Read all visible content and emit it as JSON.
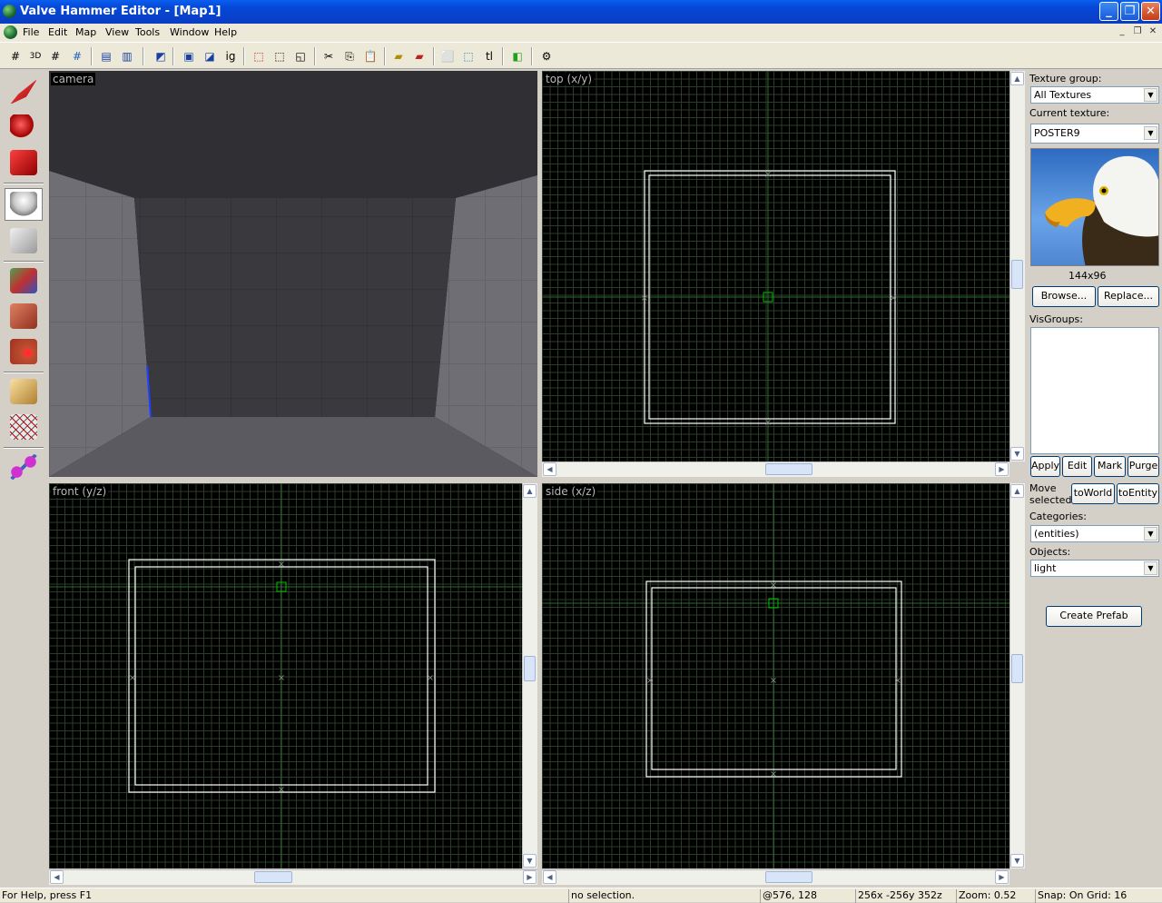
{
  "window": {
    "title": "Valve Hammer Editor - [Map1]"
  },
  "menu": {
    "items": [
      "File",
      "Edit",
      "Map",
      "View",
      "Tools",
      "Window",
      "Help"
    ]
  },
  "toolbar": {
    "ig_label": "ig",
    "tl_label": "tl"
  },
  "views": {
    "camera": "camera",
    "top": "top (x/y)",
    "front": "front (y/z)",
    "side": "side (x/z)"
  },
  "panel": {
    "texture_group_label": "Texture group:",
    "texture_group_value": "All Textures",
    "current_texture_label": "Current texture:",
    "current_texture_value": "POSTER9",
    "texture_size": "144x96",
    "browse": "Browse...",
    "replace": "Replace...",
    "visgroups_label": "VisGroups:",
    "apply": "Apply",
    "edit": "Edit",
    "mark": "Mark",
    "purge": "Purge",
    "move_label": "Move",
    "selected_label": "selected:",
    "to_world": "toWorld",
    "to_entity": "toEntity",
    "categories_label": "Categories:",
    "categories_value": "(entities)",
    "objects_label": "Objects:",
    "objects_value": "light",
    "create_prefab": "Create Prefab"
  },
  "status": {
    "help": "For Help, press F1",
    "selection": "no selection.",
    "coords": "@576, 128",
    "size": "256x -256y 352z",
    "zoom": "Zoom: 0.52",
    "snap": "Snap: On Grid: 16"
  },
  "colors": {
    "titlebar": "#0a4ddc",
    "grid_minor": "#2b3d2b",
    "grid_major": "#3c5c5c",
    "brush": "#ffffff",
    "selection": "#00c000"
  }
}
